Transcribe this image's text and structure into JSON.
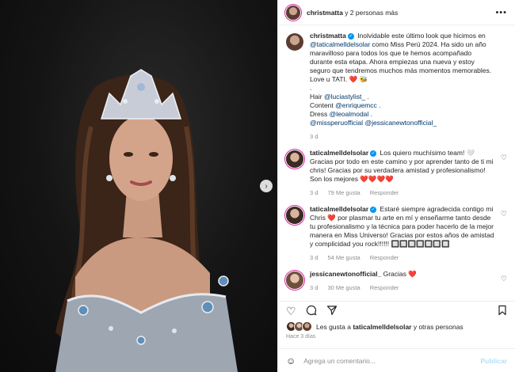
{
  "header": {
    "username": "christmatta",
    "suffix": " y 2 personas más",
    "more_icon": "ellipsis-icon"
  },
  "caption": {
    "username": "christmatta",
    "text1": " Inolvidable este último look que hicimos en ",
    "mention1": "@taticalmelldelsolar",
    "text2": " como Miss Perú 2024. Ha sido un año maravilloso para todos los que te hemos acompañado durante esta etapa. Ahora empiezas una nueva y estoy seguro que tendremos muchos más momentos memorables.",
    "love": "Love u TATI. ",
    "love_emoji": "❤️ 🐝",
    "dot": ".",
    "hair_label": "Hair ",
    "hair_mention": "@luciastylist_",
    "hair_after": " .",
    "content_label": "Content ",
    "content_mention": "@enriquemcc",
    "content_after": " .",
    "dress_label": "Dress ",
    "dress_mention": "@leoalmodal",
    "dress_after": " .",
    "final_mention1": "@missperuofficial",
    "final_mention2": "@jessicanewtonofficial_",
    "time": "3 d"
  },
  "comments": [
    {
      "username": "taticalmelldelsolar",
      "text": " Los quiero muchísimo team! 🤍 Gracias por todo en este camino y por aprender tanto de ti mi chris! Gracias por su verdadera amistad y profesionalismo! Son los mejores ",
      "hearts": "❤️❤️❤️❤️",
      "time": "3 d",
      "likes": "79 Me gusta",
      "reply": "Responder"
    },
    {
      "username": "taticalmelldelsolar",
      "text1": " Estaré siempre agradecida contigo mi Chris ",
      "heart": "❤️",
      "text2": " por plasmar tu arte en mí y enseñarme tanto desde tu profesionalismo y la técnica para poder hacerlo de la mejor manera en Miss Universo! Gracias por estos años de amistad y complicidad you rock!!!!!! ",
      "emojis": "🔲🔲🔲🔲🔲🔲🔲",
      "time": "3 d",
      "likes": "54 Me gusta",
      "reply": "Responder"
    },
    {
      "username": "jessicanewtonofficial_",
      "text": " Gracias ",
      "heart": "❤️",
      "time": "3 d",
      "likes": "30 Me gusta",
      "reply": "Responder"
    }
  ],
  "likes": {
    "prefix": "Les gusta a ",
    "user": "taticalmelldelsolar",
    "suffix": " y otras personas"
  },
  "posted": "Hace 3 días",
  "add_comment": {
    "placeholder": "Agrega un comentario...",
    "publish": "Publicar"
  },
  "icons": [
    "heart-icon",
    "comment-icon",
    "share-icon",
    "bookmark-icon",
    "emoji-icon",
    "chevron-right-icon"
  ]
}
